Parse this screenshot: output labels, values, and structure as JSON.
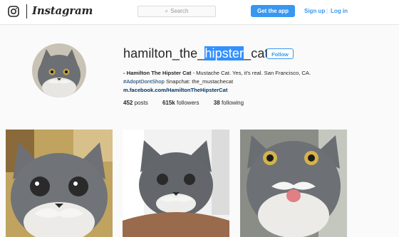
{
  "header": {
    "brand": "Instagram",
    "search_placeholder": "Search",
    "get_app_label": "Get the app",
    "sign_up_label": "Sign up",
    "separator": "|",
    "log_in_label": "Log in"
  },
  "profile": {
    "username_before": "hamilton_the_",
    "username_selected": "hipster",
    "username_after": "_cat",
    "follow_label": "Follow",
    "bio": {
      "name_prefix": "- ",
      "name": "Hamilton The Hipster Cat",
      "line1_rest": " - Mustache Cat. Yes, it's real. San Francisco, CA.",
      "hashtag": "#AdoptDontShop",
      "line2_rest": " Snapchat: the_mustachecat",
      "link": "m.facebook.com/HamiltonTheHipsterCat"
    },
    "stats": {
      "posts_count": "452",
      "posts_label": "posts",
      "followers_count": "615k",
      "followers_label": "followers",
      "following_count": "38",
      "following_label": "following"
    }
  },
  "colors": {
    "accent": "#3897f0",
    "selection": "#3390ff",
    "link": "#003569"
  },
  "icons": {
    "logo": "instagram-camera-icon",
    "search": "search-icon"
  }
}
